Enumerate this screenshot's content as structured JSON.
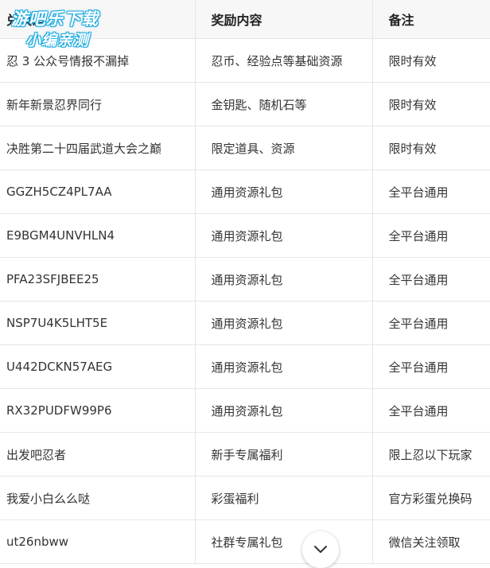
{
  "table": {
    "headers": [
      "兑换码",
      "奖励内容",
      "备注"
    ],
    "rows": [
      [
        "忍 3 公众号情报不漏掉",
        "忍币、经验点等基础资源",
        "限时有效"
      ],
      [
        "新年新景忍界同行",
        "金钥匙、随机石等",
        "限时有效"
      ],
      [
        "决胜第二十四届武道大会之巅",
        "限定道具、资源",
        "限时有效"
      ],
      [
        "GGZH5CZ4PL7AA",
        "通用资源礼包",
        "全平台通用"
      ],
      [
        "E9BGM4UNVHLN4",
        "通用资源礼包",
        "全平台通用"
      ],
      [
        "PFA23SFJBEE25",
        "通用资源礼包",
        "全平台通用"
      ],
      [
        "NSP7U4K5LHT5E",
        "通用资源礼包",
        "全平台通用"
      ],
      [
        "U442DCKN57AEG",
        "通用资源礼包",
        "全平台通用"
      ],
      [
        "RX32PUDFW99P6",
        "通用资源礼包",
        "全平台通用"
      ],
      [
        "出发吧忍者",
        "新手专属福利",
        "限上忍以下玩家"
      ],
      [
        "我爱小白么么哒",
        "彩蛋福利",
        "官方彩蛋兑换码"
      ],
      [
        "ut26nbww",
        "社群专属礼包",
        "微信关注领取"
      ]
    ]
  },
  "watermark": {
    "line1": "游吧乐下载",
    "line2": "小编亲测",
    "color": "#19a9e0"
  },
  "scroll_button": {
    "icon": "chevron-down-icon"
  }
}
